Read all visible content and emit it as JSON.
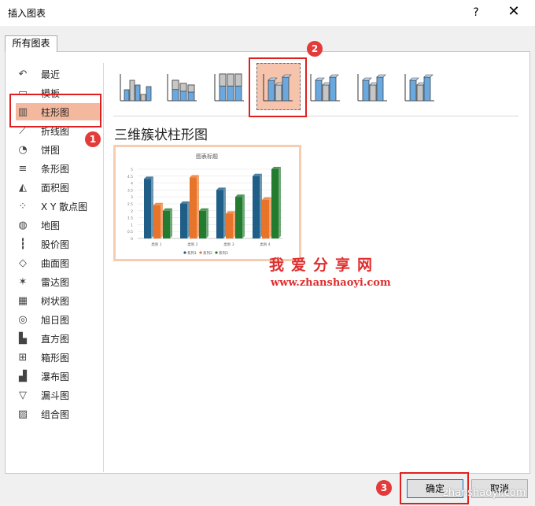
{
  "window": {
    "title": "插入图表",
    "help": "?",
    "close": "✕"
  },
  "tabs": [
    {
      "label": "所有图表"
    }
  ],
  "sidebar": {
    "items": [
      {
        "label": "最近",
        "icon": "recent-icon"
      },
      {
        "label": "模板",
        "icon": "template-icon"
      },
      {
        "label": "柱形图",
        "icon": "column-chart-icon",
        "selected": true
      },
      {
        "label": "折线图",
        "icon": "line-chart-icon"
      },
      {
        "label": "饼图",
        "icon": "pie-chart-icon"
      },
      {
        "label": "条形图",
        "icon": "bar-chart-icon"
      },
      {
        "label": "面积图",
        "icon": "area-chart-icon"
      },
      {
        "label": "X Y 散点图",
        "icon": "scatter-chart-icon"
      },
      {
        "label": "地图",
        "icon": "map-chart-icon"
      },
      {
        "label": "股价图",
        "icon": "stock-chart-icon"
      },
      {
        "label": "曲面图",
        "icon": "surface-chart-icon"
      },
      {
        "label": "雷达图",
        "icon": "radar-chart-icon"
      },
      {
        "label": "树状图",
        "icon": "treemap-chart-icon"
      },
      {
        "label": "旭日图",
        "icon": "sunburst-chart-icon"
      },
      {
        "label": "直方图",
        "icon": "histogram-chart-icon"
      },
      {
        "label": "箱形图",
        "icon": "box-whisker-chart-icon"
      },
      {
        "label": "瀑布图",
        "icon": "waterfall-chart-icon"
      },
      {
        "label": "漏斗图",
        "icon": "funnel-chart-icon"
      },
      {
        "label": "组合图",
        "icon": "combo-chart-icon"
      }
    ]
  },
  "subtypes": {
    "selected_name": "三维簇状柱形图",
    "selected_index": 3
  },
  "preview": {
    "chart_data": {
      "type": "bar",
      "title": "图表标题",
      "categories": [
        "类别 1",
        "类别 2",
        "类别 3",
        "类别 4"
      ],
      "series": [
        {
          "name": "系列1",
          "values": [
            4.3,
            2.5,
            3.5,
            4.5
          ]
        },
        {
          "name": "系列2",
          "values": [
            2.4,
            4.4,
            1.8,
            2.8
          ]
        },
        {
          "name": "系列3",
          "values": [
            2.0,
            2.0,
            3.0,
            5.0
          ]
        }
      ],
      "ylim": [
        0,
        5
      ],
      "yticks": [
        "0",
        "0.5",
        "1",
        "1.5",
        "2",
        "2.5",
        "3",
        "3.5",
        "4",
        "4.5",
        "5"
      ],
      "colors": [
        "#1f5e87",
        "#e8742a",
        "#237b2f"
      ],
      "legend": "bottom",
      "grid": true
    }
  },
  "annotations": {
    "badge1": "1",
    "badge2": "2",
    "badge3": "3"
  },
  "watermark": {
    "cn": "我爱分享网",
    "url": "www.zhanshaoyi.com",
    "corner": "zhanshaoyi.com"
  },
  "buttons": {
    "ok": "确定",
    "cancel": "取消"
  }
}
